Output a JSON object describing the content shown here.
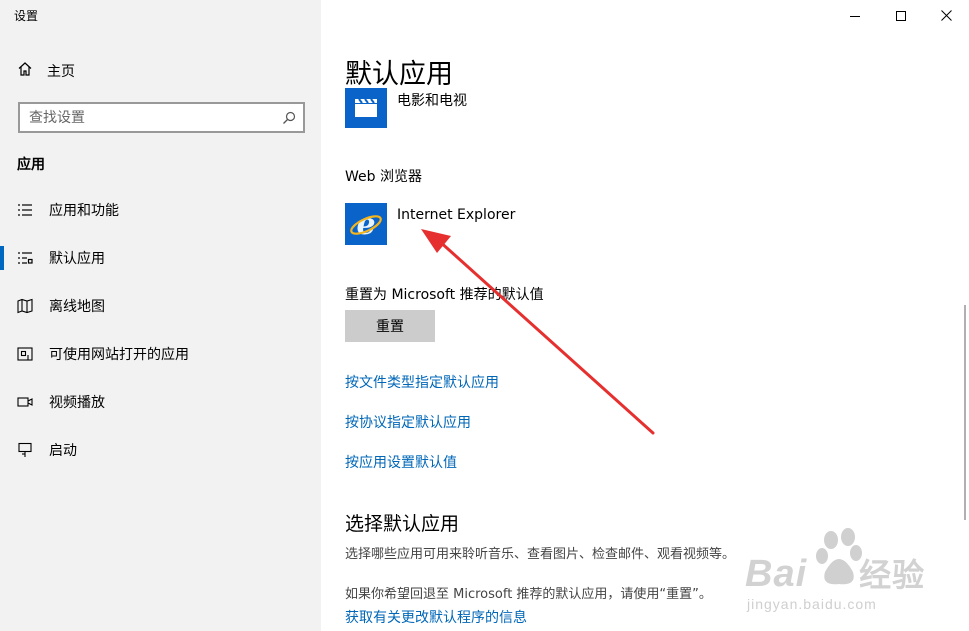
{
  "window": {
    "title": "设置"
  },
  "sidebar": {
    "home_label": "主页",
    "search_placeholder": "查找设置",
    "section_title": "应用",
    "items": [
      {
        "label": "应用和功能",
        "icon": "list-icon",
        "selected": false
      },
      {
        "label": "默认应用",
        "icon": "default-apps-icon",
        "selected": true
      },
      {
        "label": "离线地图",
        "icon": "map-icon",
        "selected": false
      },
      {
        "label": "可使用网站打开的应用",
        "icon": "web-app-icon",
        "selected": false
      },
      {
        "label": "视频播放",
        "icon": "video-icon",
        "selected": false
      },
      {
        "label": "启动",
        "icon": "startup-icon",
        "selected": false
      }
    ]
  },
  "main": {
    "title": "默认应用",
    "video_app": {
      "name": "电影和电视"
    },
    "web_browser": {
      "heading": "Web 浏览器",
      "app": "Internet Explorer"
    },
    "reset": {
      "heading": "重置为 Microsoft 推荐的默认值",
      "button": "重置"
    },
    "links": [
      "按文件类型指定默认应用",
      "按协议指定默认应用",
      "按应用设置默认值"
    ],
    "choose": {
      "title": "选择默认应用",
      "desc1": "选择哪些应用可用来聆听音乐、查看图片、检查邮件、观看视频等。",
      "desc2": "如果你希望回退至 Microsoft 推荐的默认应用，请使用“重置”。",
      "link": "获取有关更改默认程序的信息"
    }
  },
  "watermark": {
    "brand": "Bai",
    "brand_cn": "经验",
    "url": "jingyan.baidu.com"
  },
  "colors": {
    "accent": "#0067c0",
    "link": "#0067b8",
    "arrow": "#e5302f",
    "sidebar_bg": "#f2f2f2"
  }
}
